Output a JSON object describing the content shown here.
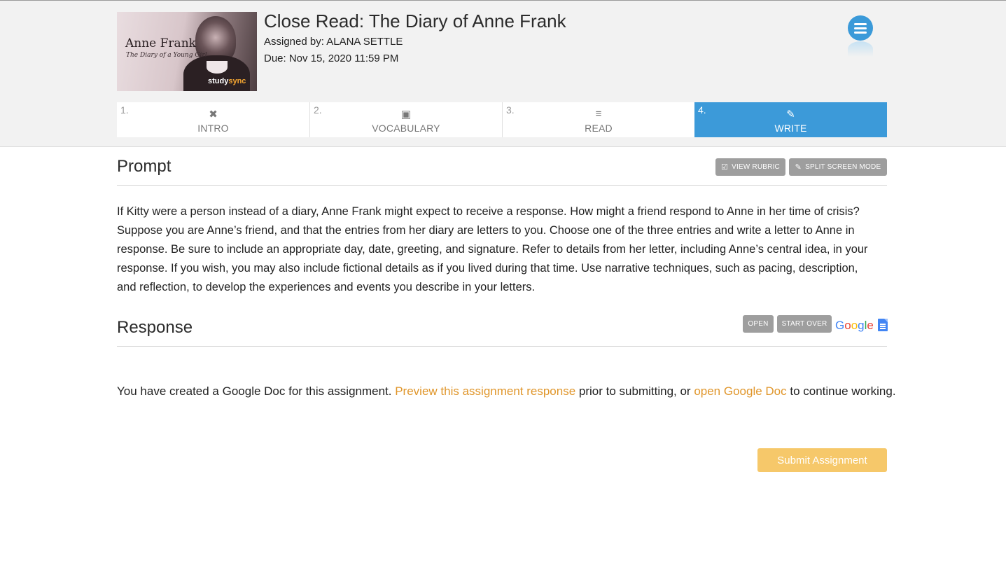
{
  "header": {
    "cover": {
      "title": "Anne Frank",
      "subtitle": "The Diary of a Young Girl",
      "logo_a": "study",
      "logo_b": "sync"
    },
    "assignment_title": "Close Read: The Diary of Anne Frank",
    "assigned_by": "Assigned by: ALANA SETTLE",
    "due": "Due: Nov 15, 2020 11:59 PM",
    "menu_icon": "hamburger-menu-icon"
  },
  "tabs": [
    {
      "num": "1.",
      "label": "INTRO",
      "icon": "✖"
    },
    {
      "num": "2.",
      "label": "VOCABULARY",
      "icon": "▣"
    },
    {
      "num": "3.",
      "label": "READ",
      "icon": "≡"
    },
    {
      "num": "4.",
      "label": "WRITE",
      "icon": "✎"
    }
  ],
  "active_tab": "WRITE",
  "prompt": {
    "heading": "Prompt",
    "view_rubric": "VIEW RUBRIC",
    "split_screen": "SPLIT SCREEN MODE",
    "text": "If Kitty were a person instead of a diary, Anne Frank might expect to receive a response. How might a friend respond to Anne in her time of crisis? Suppose you are Anne’s friend, and that the entries from her diary are letters to you. Choose one of the three entries and write a letter to Anne in response. Be sure to include an appropriate day, date, greeting, and signature. Refer to details from her letter, including Anne’s central idea, in your response. If you wish, you may also include fictional details as if you lived during that time. Use narrative techniques, such as pacing, description, and reflection, to develop the experiences and events you describe in your letters."
  },
  "response": {
    "heading": "Response",
    "open": "OPEN",
    "start_over": "START OVER",
    "google_logo": "Google",
    "notice_part1": "You have created a Google Doc for this assignment. ",
    "preview_link": "Preview this assignment response",
    "notice_part2": " prior to submitting, or ",
    "open_doc_link": "open Google Doc",
    "notice_part3": " to continue working."
  },
  "submit_label": "Submit Assignment",
  "colors": {
    "accent_blue": "#3c9ad9",
    "link_orange": "#e0962b",
    "submit_yellow": "#f6c86a",
    "gray_button": "#9e9e9e"
  }
}
